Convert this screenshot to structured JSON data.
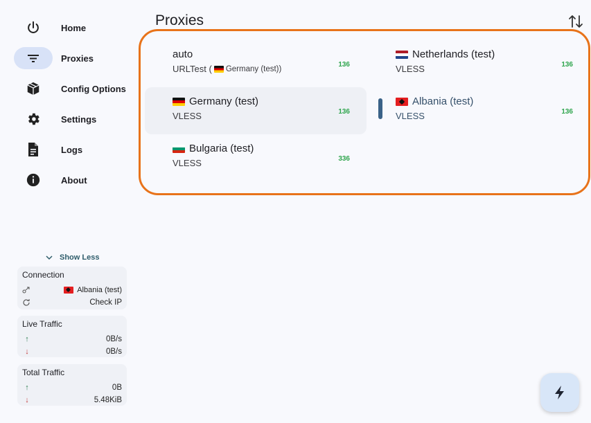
{
  "nav": {
    "items": [
      {
        "label": "Home",
        "icon": "power-icon"
      },
      {
        "label": "Proxies",
        "icon": "filter-icon"
      },
      {
        "label": "Config Options",
        "icon": "box-icon"
      },
      {
        "label": "Settings",
        "icon": "gear-icon"
      },
      {
        "label": "Logs",
        "icon": "document-icon"
      },
      {
        "label": "About",
        "icon": "info-icon"
      }
    ],
    "active_index": 1
  },
  "sidebar": {
    "show_less_label": "Show Less",
    "connection": {
      "title": "Connection",
      "proxy": "Albania (test)",
      "check_ip": "Check IP"
    },
    "live_traffic": {
      "title": "Live Traffic",
      "up": "0B/s",
      "down": "0B/s"
    },
    "total_traffic": {
      "title": "Total Traffic",
      "up": "0B",
      "down": "5.48KiB"
    }
  },
  "main": {
    "title": "Proxies",
    "proxies": [
      {
        "name": "auto",
        "type": "URLTest (",
        "type_flag": "Germany (test))",
        "ping": "136"
      },
      {
        "name": "Netherlands (test)",
        "type": "VLESS",
        "ping": "136"
      },
      {
        "name": "Germany (test)",
        "type": "VLESS",
        "ping": "136"
      },
      {
        "name": "Albania (test)",
        "type": "VLESS",
        "ping": "136"
      },
      {
        "name": "Bulgaria (test)",
        "type": "VLESS",
        "ping": "336"
      }
    ]
  },
  "colors": {
    "accent": "#e8731a",
    "ping": "#2fa54d",
    "selected": "#3a6288",
    "background": "#f8f9fd"
  }
}
